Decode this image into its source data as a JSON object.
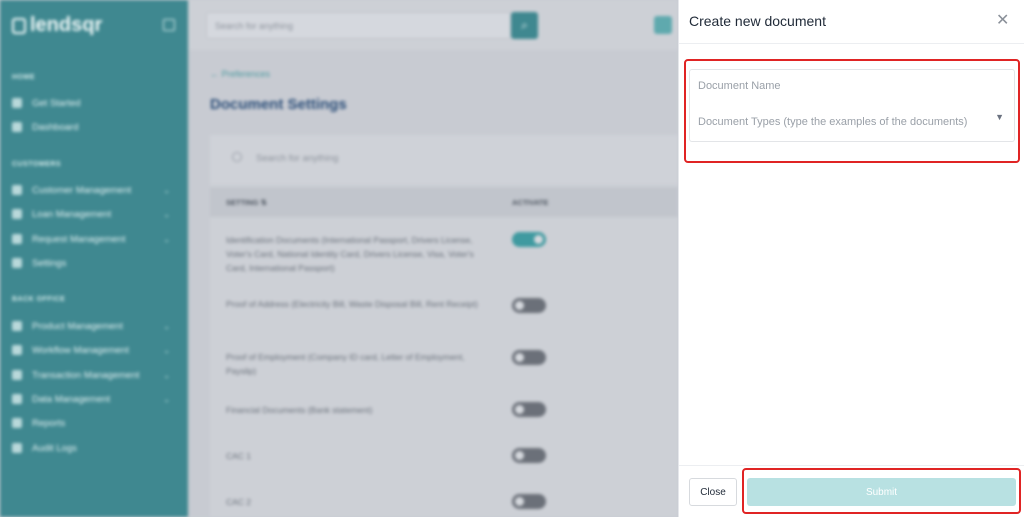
{
  "app": {
    "logo_text": "lendsqr",
    "search_placeholder": "Search for anything"
  },
  "sidebar": {
    "sections": [
      {
        "label": "HOME"
      },
      {
        "label": "CUSTOMERS"
      },
      {
        "label": "BACK OFFICE"
      }
    ],
    "items": [
      {
        "label": "Get Started",
        "icon": "home-icon"
      },
      {
        "label": "Dashboard",
        "icon": "dashboard-icon"
      },
      {
        "label": "Customer Management",
        "icon": "users-icon"
      },
      {
        "label": "Loan Management",
        "icon": "loan-icon"
      },
      {
        "label": "Request Management",
        "icon": "request-icon"
      },
      {
        "label": "Settings",
        "icon": "settings-icon"
      },
      {
        "label": "Product Management",
        "icon": "product-icon"
      },
      {
        "label": "Workflow Management",
        "icon": "workflow-icon"
      },
      {
        "label": "Transaction Management",
        "icon": "transaction-icon"
      },
      {
        "label": "Data Management",
        "icon": "data-icon"
      },
      {
        "label": "Reports",
        "icon": "reports-icon"
      },
      {
        "label": "Audit Logs",
        "icon": "audit-icon"
      }
    ]
  },
  "main": {
    "breadcrumb": "Preferences",
    "title": "Document Settings",
    "table_search_placeholder": "Search for anything",
    "columns": [
      "SETTING",
      "ACTIVATE"
    ],
    "rows": [
      {
        "setting": "Identification Documents (International Passport, Drivers License, Voter's Card, National Identity Card, Drivers License, Visa, Voter's Card, International Passport)",
        "active": true
      },
      {
        "setting": "Proof of Address (Electricity Bill, Waste Disposal Bill, Rent Receipt)",
        "active": false
      },
      {
        "setting": "Proof of Employment (Company ID card, Letter of Employment, Payslip)",
        "active": false
      },
      {
        "setting": "Financial Documents (Bank statement)",
        "active": false
      },
      {
        "setting": "CAC 1",
        "active": false
      },
      {
        "setting": "CAC 2",
        "active": false
      }
    ]
  },
  "modal": {
    "title": "Create new document",
    "document_name_placeholder": "Document Name",
    "document_name_value": "",
    "document_types_placeholder": "Document Types (type the examples of the documents)",
    "close_label": "Close",
    "submit_label": "Submit",
    "highlight_color": "#e02424",
    "submit_color": "#b8e1e2"
  }
}
